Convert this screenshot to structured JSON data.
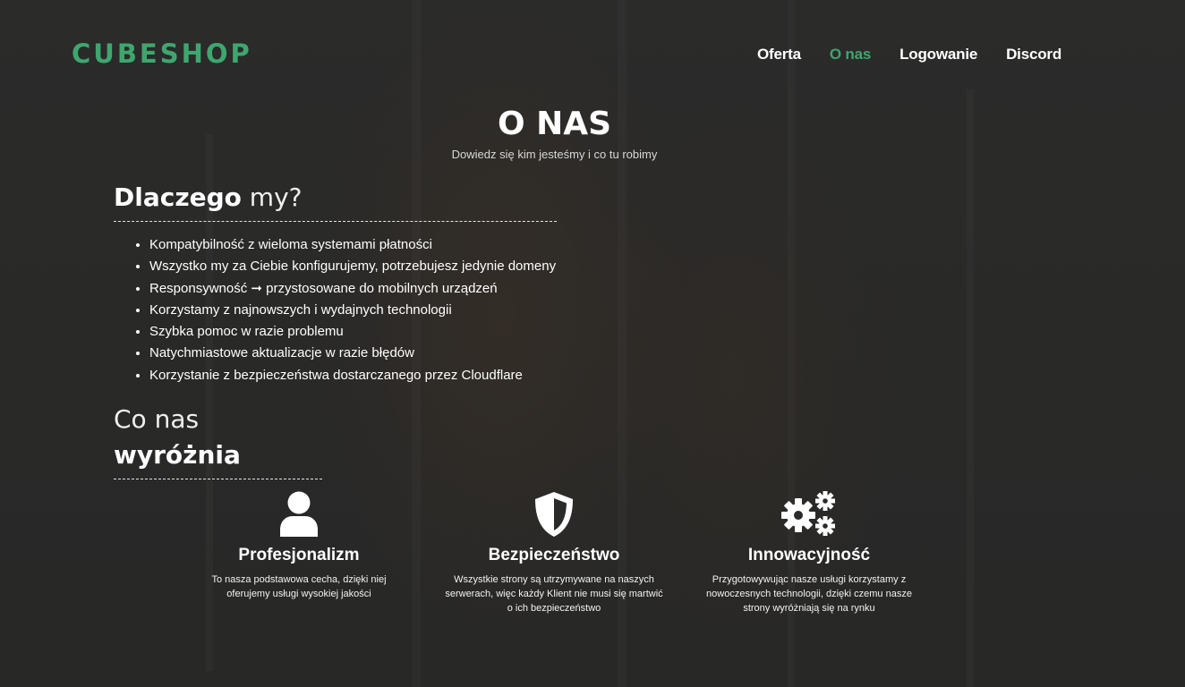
{
  "header": {
    "logo": "CUBESHOP",
    "nav": [
      {
        "label": "Oferta"
      },
      {
        "label": "O nas"
      },
      {
        "label": "Logowanie"
      },
      {
        "label": "Discord"
      }
    ]
  },
  "hero": {
    "title": "O NAS",
    "subtitle": "Dowiedz się kim jesteśmy i co tu robimy"
  },
  "why": {
    "heading_strong": "Dlaczego",
    "heading_light": " my?",
    "items": [
      "Kompatybilność z wieloma systemami płatności",
      "Wszystko my za Ciebie konfigurujemy, potrzebujesz jedynie domeny",
      "Responsywność ➞ przystosowane do mobilnych urządzeń",
      "Korzystamy z najnowszych i wydajnych technologii",
      "Szybka pomoc w razie problemu",
      "Natychmiastowe aktualizacje w razie błędów",
      "Korzystanie z bezpieczeństwa dostarczanego przez Cloudflare"
    ]
  },
  "difference": {
    "heading_light": "Co nas ",
    "heading_strong": "wyróżnia"
  },
  "features": [
    {
      "icon": "user-icon",
      "title": "Profesjonalizm",
      "description": "To nasza podstawowa cecha, dzięki niej oferujemy usługi wysokiej jakości"
    },
    {
      "icon": "shield-icon",
      "title": "Bezpieczeństwo",
      "description": "Wszystkie strony są utrzymywane na naszych serwerach, więc każdy Klient nie musi się martwić o ich bezpieczeństwo"
    },
    {
      "icon": "gears-icon",
      "title": "Innowacyjność",
      "description": "Przygotowywując nasze usługi korzystamy z nowoczesnych technologii, dzięki czemu nasze strony wyróżniają się na rynku"
    }
  ],
  "colors": {
    "accent": "#3fa66e",
    "background": "#2a2a29",
    "text": "#ffffff"
  }
}
